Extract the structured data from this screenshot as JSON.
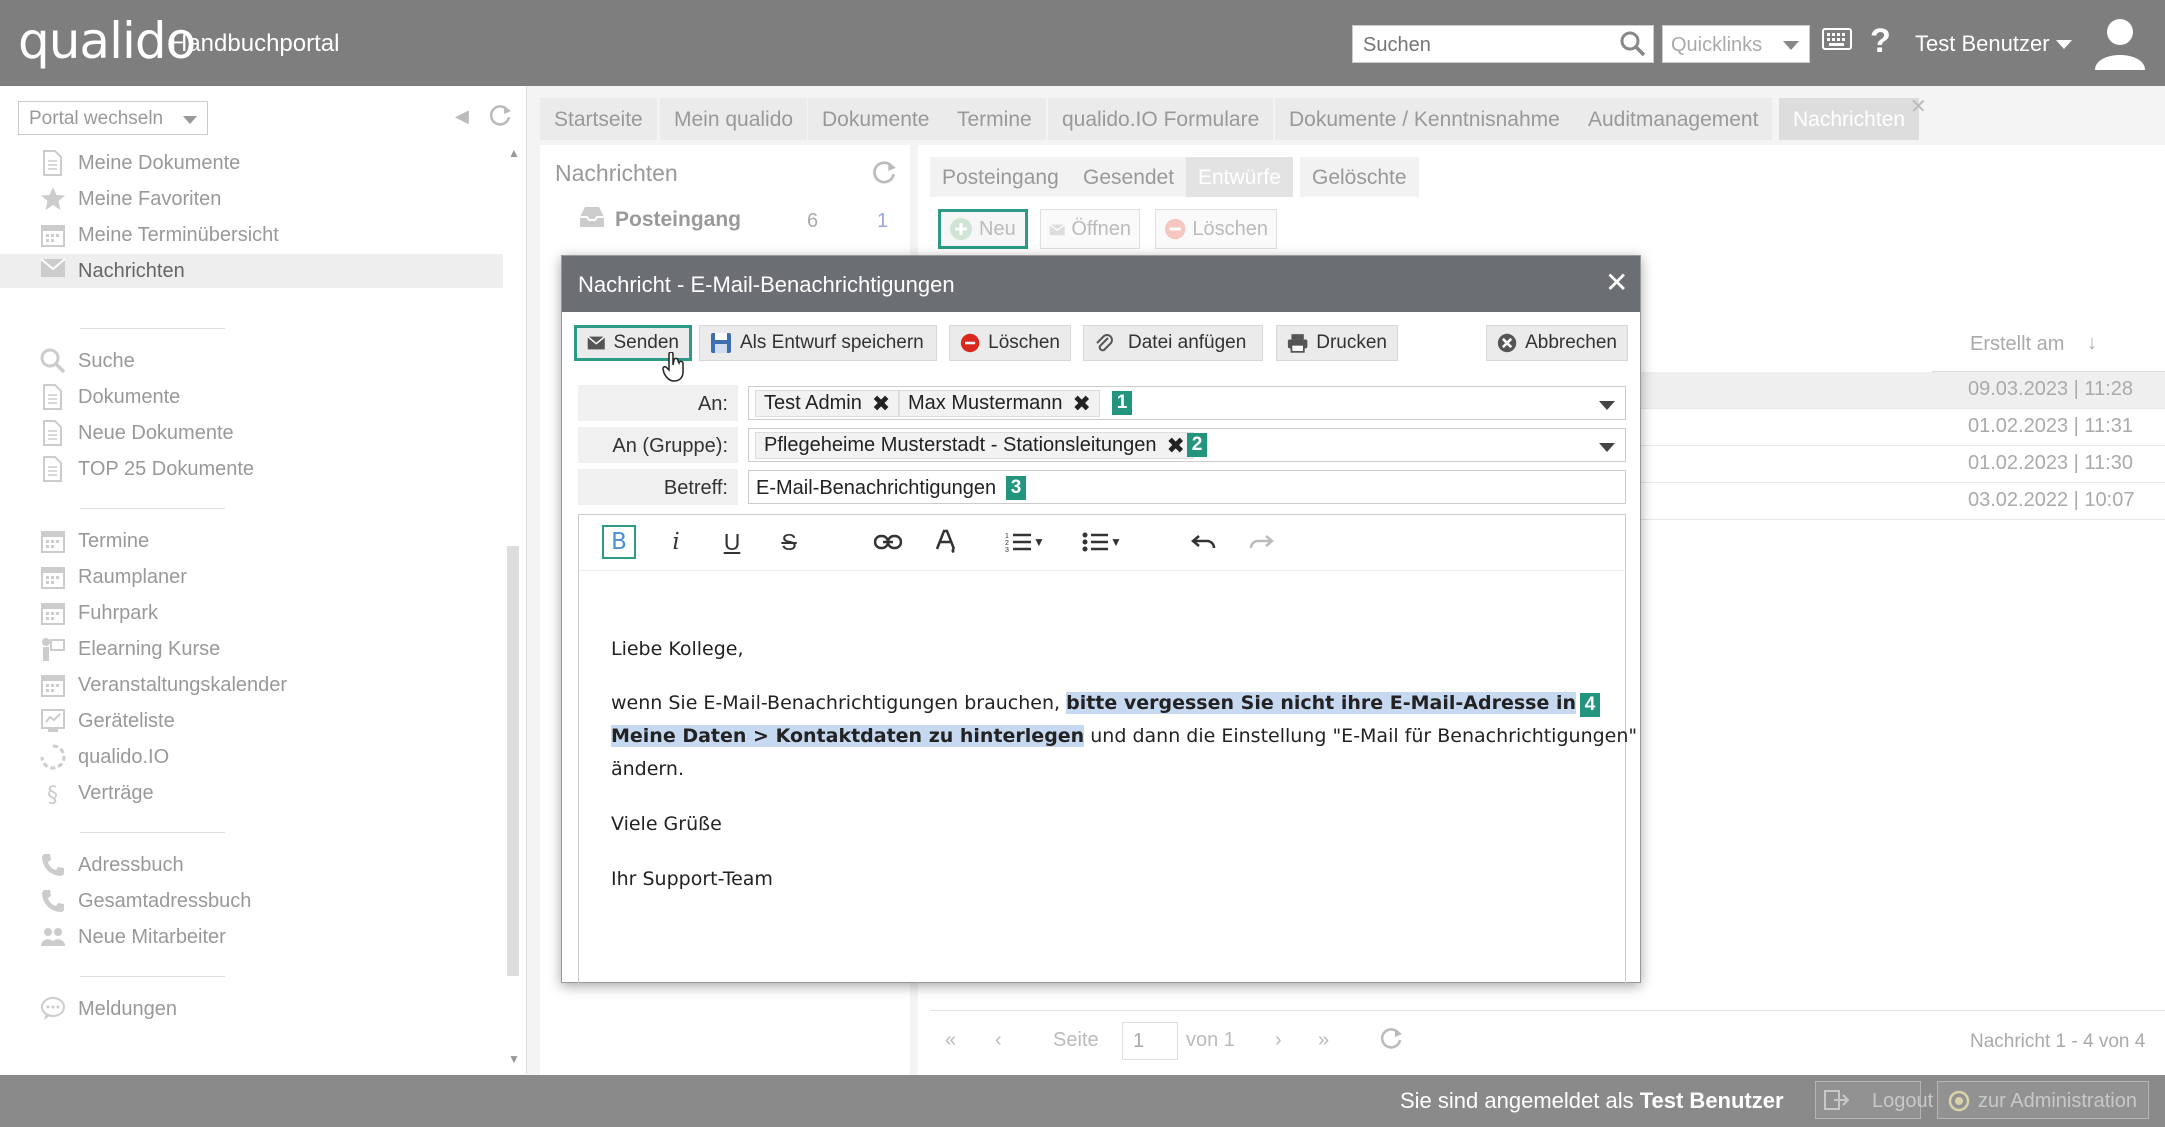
{
  "app": {
    "logo": "qualido",
    "portal_title": "Handbuchportal",
    "search_placeholder": "Suchen",
    "quicklinks_label": "Quicklinks",
    "help_symbol": "?",
    "user_name": "Test Benutzer"
  },
  "sidebar": {
    "portal_switch": "Portal wechseln",
    "items": [
      {
        "label": "Meine Dokumente",
        "icon": "document-icon"
      },
      {
        "label": "Meine Favoriten",
        "icon": "star-icon"
      },
      {
        "label": "Meine Terminübersicht",
        "icon": "calendar-icon"
      },
      {
        "label": "Nachrichten",
        "icon": "mail-icon",
        "active": true
      },
      {
        "label": "Suche",
        "icon": "search-icon"
      },
      {
        "label": "Dokumente",
        "icon": "document-icon"
      },
      {
        "label": "Neue Dokumente",
        "icon": "document-icon"
      },
      {
        "label": "TOP 25 Dokumente",
        "icon": "document-icon"
      },
      {
        "label": "Termine",
        "icon": "calendar-icon"
      },
      {
        "label": "Raumplaner",
        "icon": "calendar-icon"
      },
      {
        "label": "Fuhrpark",
        "icon": "calendar-icon"
      },
      {
        "label": "Elearning Kurse",
        "icon": "teacher-icon"
      },
      {
        "label": "Veranstaltungskalender",
        "icon": "calendar-icon"
      },
      {
        "label": "Geräteliste",
        "icon": "device-icon"
      },
      {
        "label": "qualido.IO",
        "icon": "loader-icon"
      },
      {
        "label": "Verträge",
        "icon": "paragraph-icon"
      },
      {
        "label": "Adressbuch",
        "icon": "phone-icon"
      },
      {
        "label": "Gesamtadressbuch",
        "icon": "phone-icon"
      },
      {
        "label": "Neue Mitarbeiter",
        "icon": "people-icon"
      },
      {
        "label": "Meldungen",
        "icon": "chat-icon"
      }
    ]
  },
  "main_tabs": [
    {
      "label": "Startseite"
    },
    {
      "label": "Mein qualido"
    },
    {
      "label": "Dokumente"
    },
    {
      "label": "Termine"
    },
    {
      "label": "qualido.IO Formulare"
    },
    {
      "label": "Dokumente / Kenntnisnahme"
    },
    {
      "label": "Auditmanagement"
    },
    {
      "label": "Nachrichten",
      "active": true
    }
  ],
  "messages_nav": {
    "heading": "Nachrichten",
    "inbox_label": "Posteingang",
    "inbox_count": "6",
    "inbox_unread": "1"
  },
  "subtabs": [
    {
      "label": "Posteingang"
    },
    {
      "label": "Gesendet"
    },
    {
      "label": "Entwürfe",
      "active": true
    },
    {
      "label": "Gelöschte"
    }
  ],
  "list_toolbar": {
    "new": "Neu",
    "open": "Öffnen",
    "delete": "Löschen"
  },
  "list": {
    "col_created": "Erstellt am",
    "rows": [
      {
        "created": "09.03.2023 | 11:28"
      },
      {
        "created": "01.02.2023 | 11:31"
      },
      {
        "created": "01.02.2023 | 11:30"
      },
      {
        "created": "03.02.2022 | 10:07"
      }
    ]
  },
  "pager": {
    "page_label": "Seite",
    "page_value": "1",
    "of_label": "von 1",
    "range": "Nachricht 1 - 4 von 4"
  },
  "footer": {
    "logged_prefix": "Sie sind angemeldet als",
    "logged_user": "Test Benutzer",
    "logout": "Logout",
    "admin": "zur Administration"
  },
  "modal": {
    "title": "Nachricht - E-Mail-Benachrichtigungen",
    "buttons": {
      "send": "Senden",
      "save_draft": "Als Entwurf speichern",
      "delete": "Löschen",
      "attach": "Datei anfügen",
      "print": "Drucken",
      "cancel": "Abbrechen"
    },
    "fields": {
      "to_label": "An:",
      "to_recipients": [
        "Test Admin",
        "Max Mustermann"
      ],
      "group_label": "An (Gruppe):",
      "group_recipients": [
        "Pflegeheime Musterstadt - Stationsleitungen"
      ],
      "subject_label": "Betreff:",
      "subject_value": "E-Mail-Benachrichtigungen"
    },
    "badges": [
      "1",
      "2",
      "3",
      "4"
    ],
    "body": {
      "greeting": "Liebe Kollege,",
      "line1_plain": "wenn Sie E-Mail-Benachrichtigungen brauchen, ",
      "line1_bold": "bitte vergessen Sie nicht ihre E-Mail-Adresse in ",
      "line2_bold": "Meine Daten > Kontaktdaten zu hinterlegen",
      "line2_plain": " und dann die Einstellung \"E-Mail für Benachrichtigungen\"",
      "line3": " ändern.",
      "closing": "Viele Grüße",
      "signature": "Ihr Support-Team"
    }
  },
  "colors": {
    "topbar": "#7e7e7e",
    "accent": "#2c9a86",
    "badge": "#23957f",
    "highlight": "#c7d9f1",
    "modal_header": "#6b6e73"
  }
}
